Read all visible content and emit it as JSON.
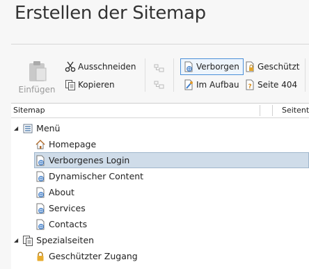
{
  "title": "Erstellen der Sitemap",
  "toolbar": {
    "paste": "Einfügen",
    "cut": "Ausschneiden",
    "copy": "Kopieren",
    "hidden": "Verborgen",
    "protected": "Geschützt",
    "under_construction": "Im Aufbau",
    "page_404": "Seite 404"
  },
  "tree": {
    "columns": [
      "Sitemap",
      "Seitent"
    ],
    "groups": [
      {
        "label": "Menü",
        "items": [
          "Homepage",
          "Verborgenes Login",
          "Dynamischer Content",
          "About",
          "Services",
          "Contacts"
        ]
      },
      {
        "label": "Spezialseiten",
        "items": [
          "Geschützter Zugang"
        ]
      }
    ]
  },
  "selected_item": "Verborgenes Login",
  "colors": {
    "selection": "#cfdce9",
    "accent": "#4a8fd8"
  }
}
